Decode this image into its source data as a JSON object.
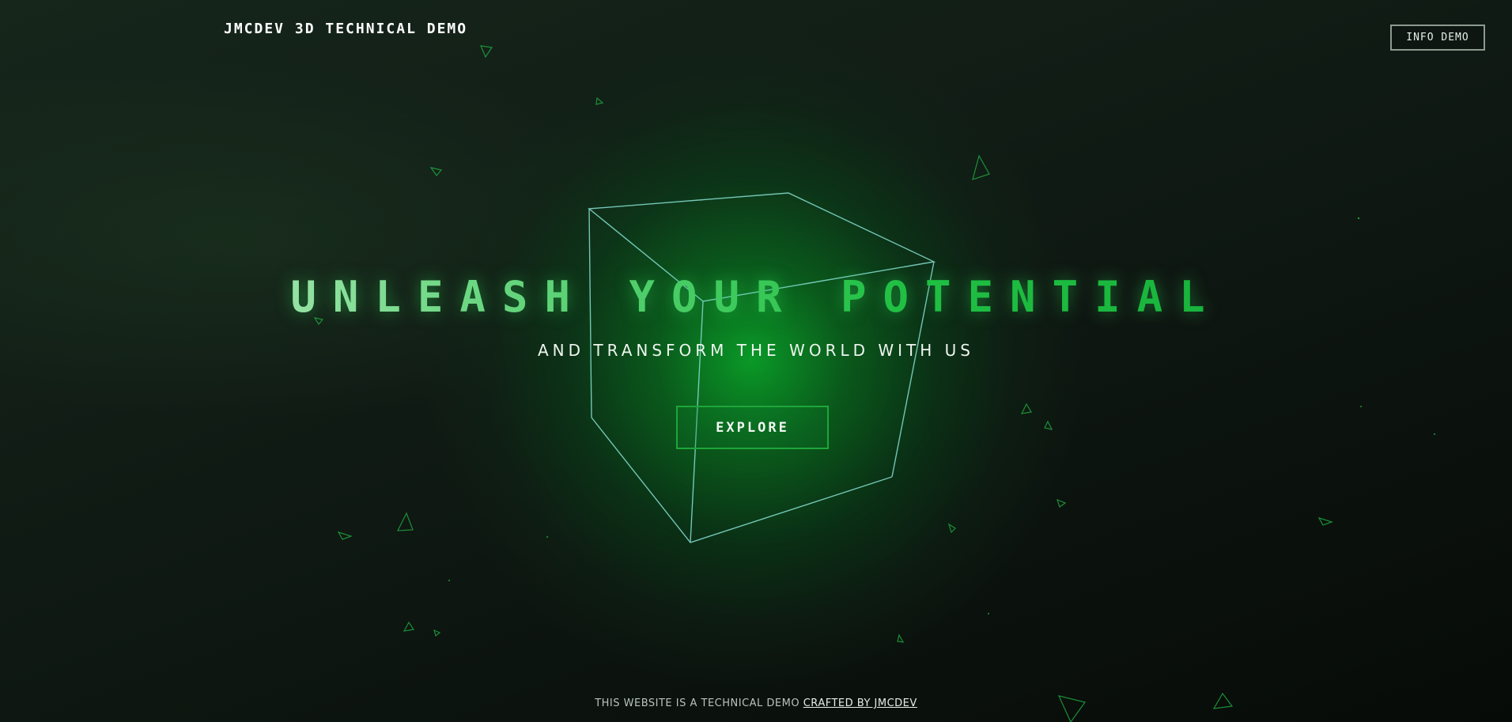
{
  "header": {
    "logo_text": "JMCDEV 3D TECHNICAL DEMO",
    "info_button_label": "INFO DEMO"
  },
  "hero": {
    "headline": "UNLEASH YOUR POTENTIAL",
    "subheadline": "AND TRANSFORM THE WORLD WITH US",
    "cta_label": "EXPLORE"
  },
  "footer": {
    "text": "THIS WEBSITE IS A TECHNICAL DEMO",
    "link_text": "CRAFTED BY JMCDEV"
  },
  "colors": {
    "accent": "#1ea63a",
    "glow": "#0aa028",
    "cube_stroke": "#7fd6c8",
    "background": "#0e1410"
  },
  "icons": {
    "cube": "wireframe-cube-icon",
    "particle": "triangle-particle-icon"
  }
}
